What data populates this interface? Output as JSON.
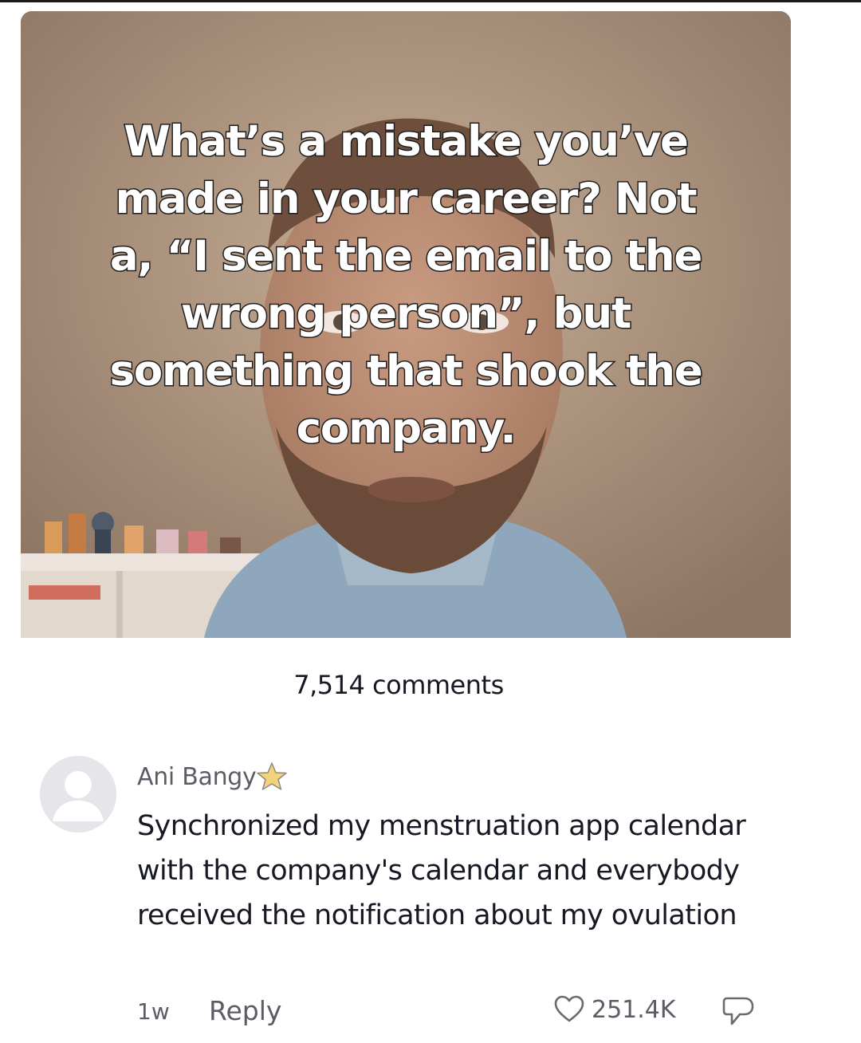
{
  "post": {
    "overlay_text": "What’s a mistake you’ve\nmade in your career? Not\na, “I sent the email to the\nwrong person”, but\nsomething that shook the\ncompany.",
    "comments_count": "7,514 comments"
  },
  "comment": {
    "username": "Ani Bangy",
    "badge_icon": "star-icon",
    "text": "Synchronized my menstruation app calendar with the company's calendar and everybody received the notification about my ovulation",
    "timestamp": "1w",
    "reply_label": "Reply",
    "like_count": "251.4K"
  },
  "colors": {
    "text_primary": "#161823",
    "text_secondary": "#5c5c66",
    "star": "#f0c24a"
  }
}
